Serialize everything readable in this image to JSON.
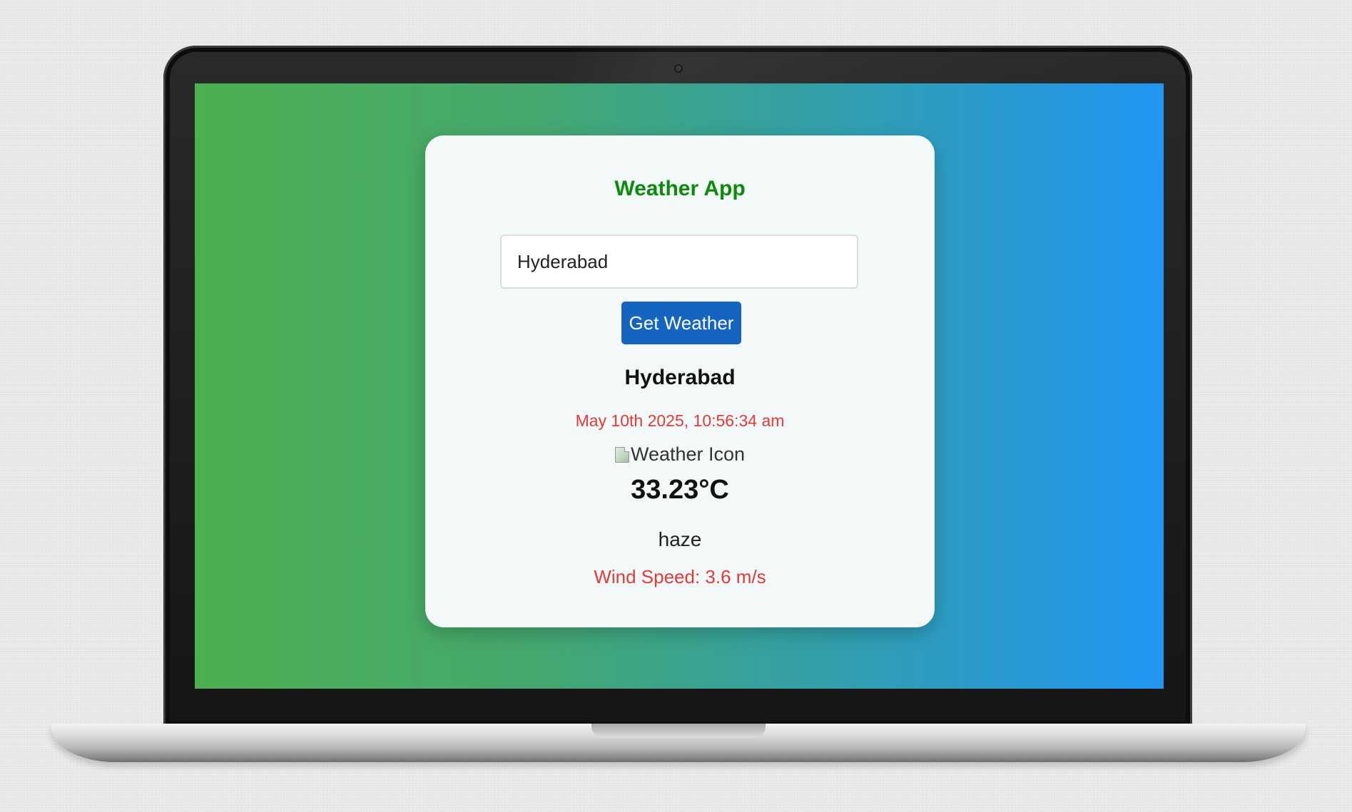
{
  "app": {
    "title": "Weather App"
  },
  "search": {
    "value": "Hyderabad",
    "button_label": "Get Weather"
  },
  "weather": {
    "city": "Hyderabad",
    "datetime": "May 10th 2025, 10:56:34 am",
    "icon_alt": "Weather Icon",
    "temperature": "33.23°C",
    "description": "haze",
    "wind_speed": "Wind Speed: 3.6 m/s"
  },
  "colors": {
    "title": "#0b8a0b",
    "button": "#1565c0",
    "accent_red": "#e53935",
    "gradient_start": "#4caf50",
    "gradient_end": "#2196f3",
    "card_background": "#f3f9f9"
  }
}
